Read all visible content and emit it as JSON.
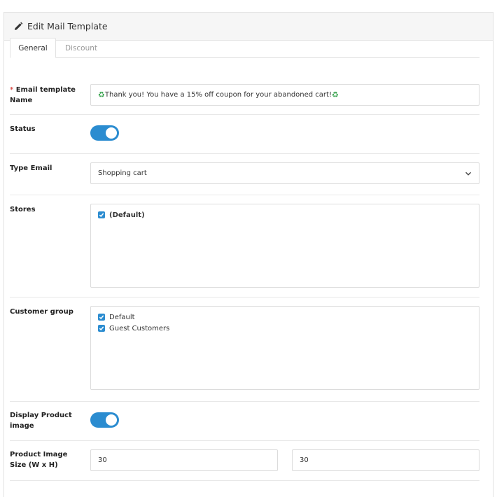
{
  "header": {
    "title": "Edit Mail Template",
    "icon": "pencil-icon"
  },
  "tabs": [
    {
      "label": "General",
      "active": true
    },
    {
      "label": "Discount",
      "active": false
    }
  ],
  "form": {
    "template_name": {
      "required_mark": "*",
      "label_line1": "Email template",
      "label_line2": "Name",
      "value": "Thank you! You have a 15% off coupon for your abandoned cart!",
      "emoji": "♻"
    },
    "status": {
      "label": "Status",
      "enabled": true
    },
    "type_email": {
      "label": "Type Email",
      "value": "Shopping cart"
    },
    "stores": {
      "label": "Stores",
      "options": [
        {
          "label": "(Default)",
          "checked": true
        }
      ]
    },
    "customer_group": {
      "label": "Customer group",
      "options": [
        {
          "label": "Default",
          "checked": true
        },
        {
          "label": "Guest Customers",
          "checked": true
        }
      ]
    },
    "display_product_image": {
      "label_line1": "Display Product",
      "label_line2": "image",
      "enabled": true
    },
    "product_image_size": {
      "label_line1": "Product Image",
      "label_line2": "Size (W x H)",
      "width": "30",
      "height": "30"
    }
  },
  "colors": {
    "accent": "#2b8cd0",
    "required": "#d9534f",
    "recycle": "#2e9e45"
  }
}
